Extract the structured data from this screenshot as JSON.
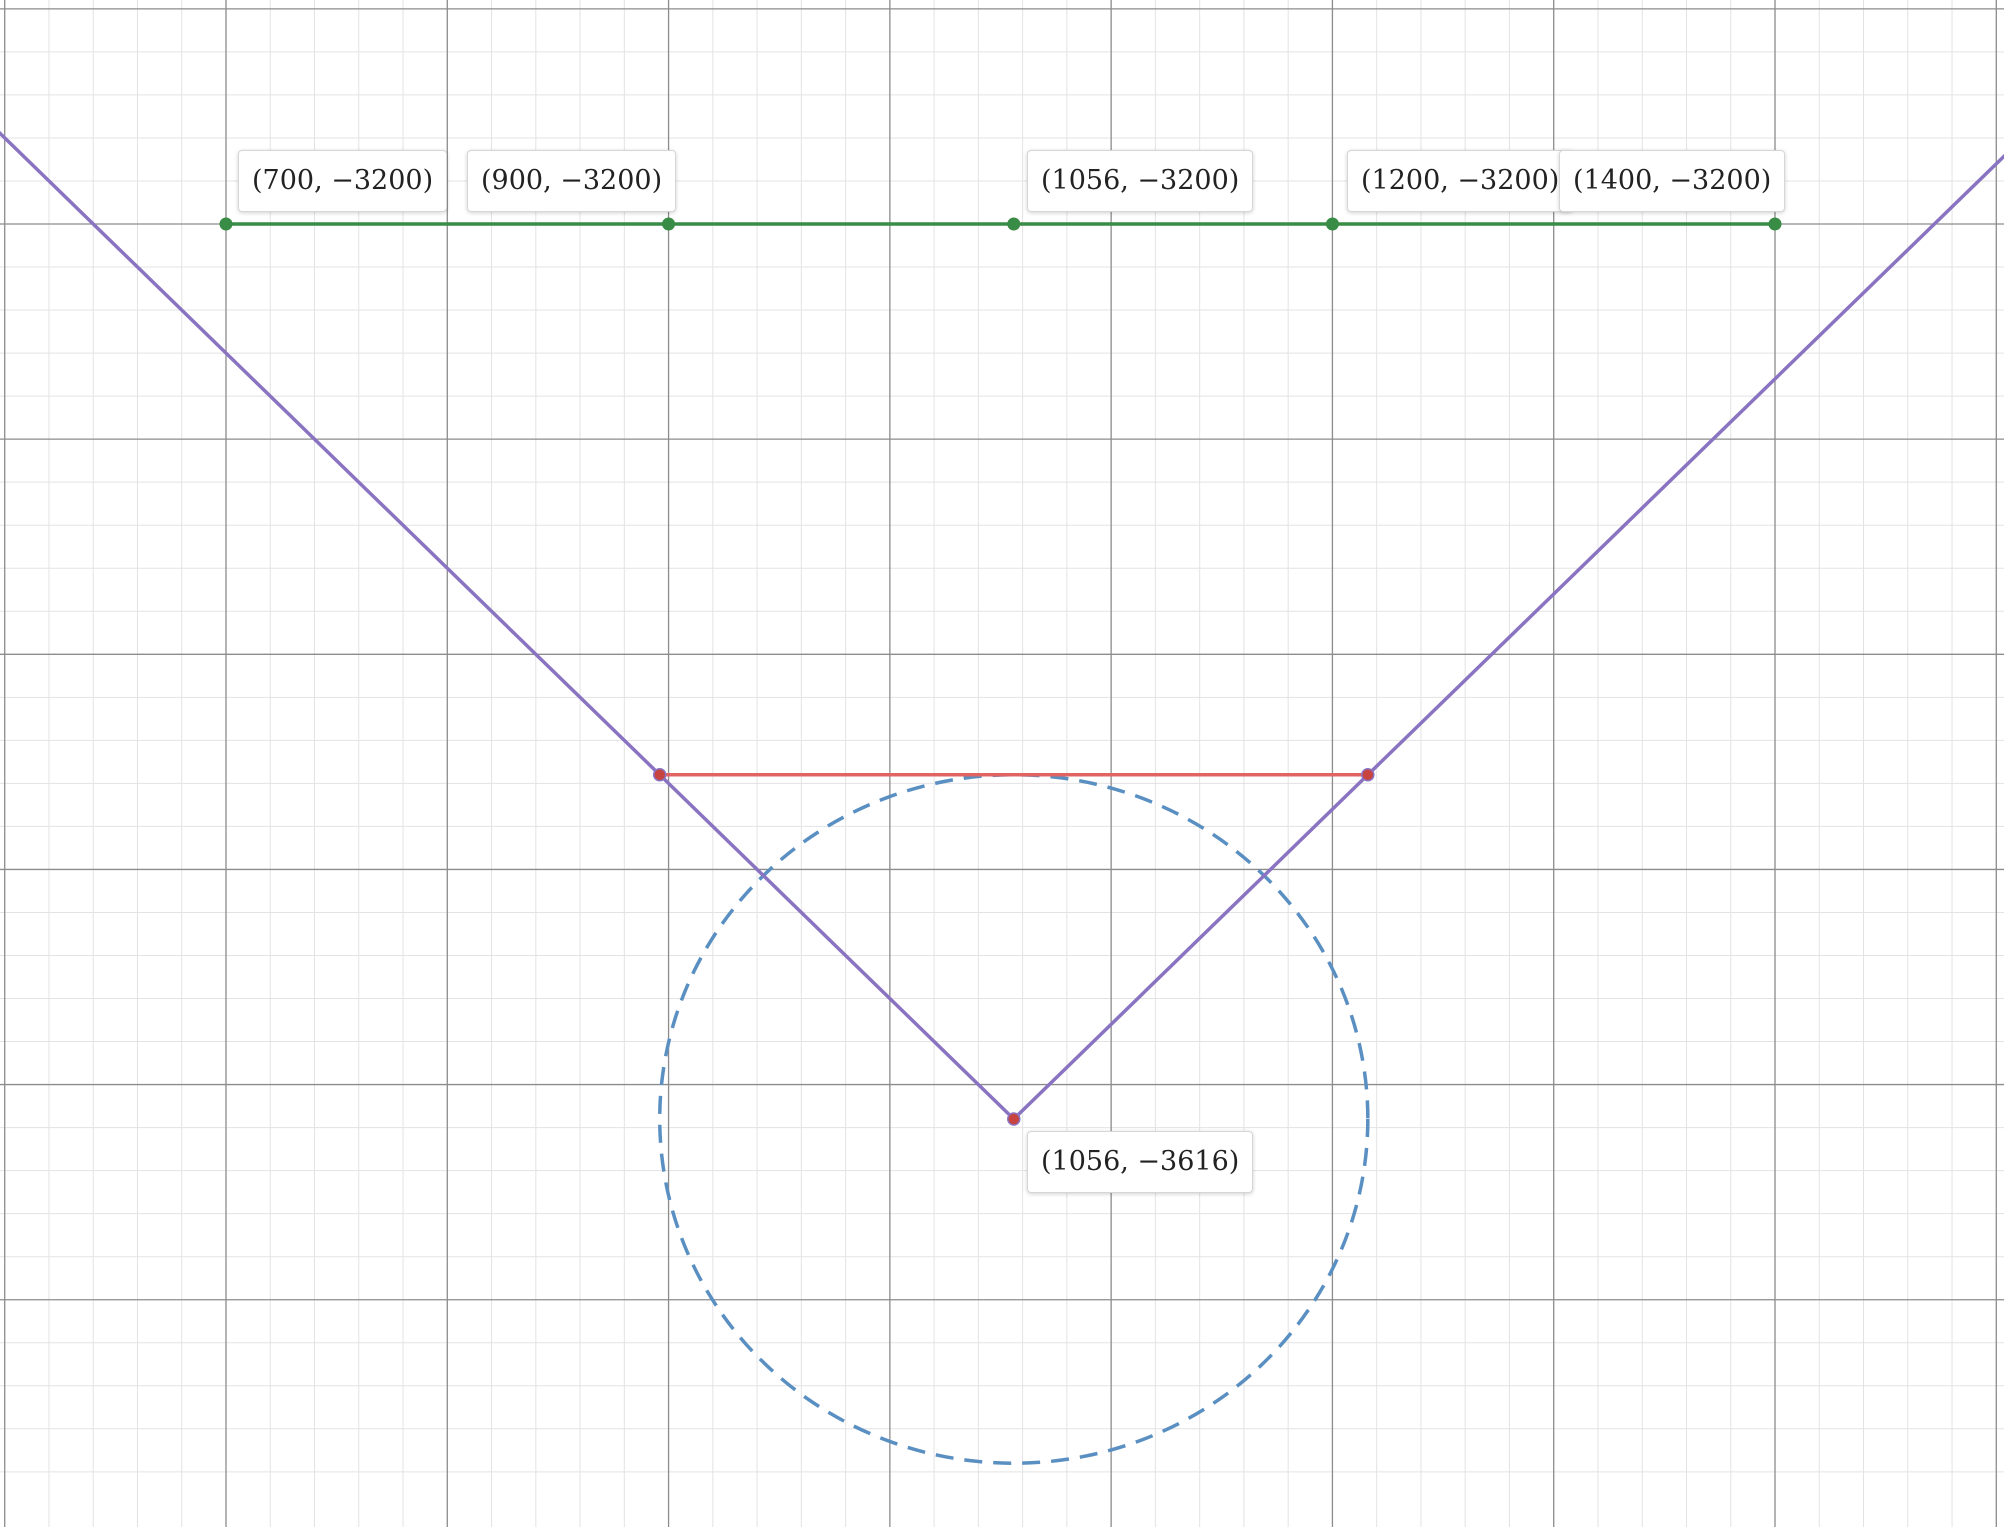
{
  "graph": {
    "background": "#ffffff",
    "colors": {
      "minor_grid": "#e3e3e3",
      "major_grid": "#8c8c8c",
      "green_line": "#388c46",
      "purple_line": "#8a74c2",
      "red_line": "#e06464",
      "red_point": "#c74440",
      "circle": "#5a8fc2"
    },
    "x_range": [
      600,
      1500
    ],
    "y_range": [
      -3780,
      -3100
    ],
    "x_major_step": 100,
    "y_major_step": 100,
    "minor_per_major": 5,
    "green_segment": {
      "y": -3200,
      "x_from": 700,
      "x_to": 1400,
      "points": [
        {
          "x": 700,
          "y": -3200
        },
        {
          "x": 900,
          "y": -3200
        },
        {
          "x": 1056,
          "y": -3200
        },
        {
          "x": 1200,
          "y": -3200
        },
        {
          "x": 1400,
          "y": -3200
        }
      ]
    },
    "v_curve": {
      "vertex": {
        "x": 1056,
        "y": -3616
      },
      "slope": 1
    },
    "red_segment": {
      "from": {
        "x": 896,
        "y": -3456
      },
      "to": {
        "x": 1216,
        "y": -3456
      }
    },
    "circle": {
      "center": {
        "x": 1056,
        "y": -3616
      },
      "radius": 160,
      "dashed": true
    },
    "labels": [
      {
        "text": "(700, −3200)",
        "x": 700,
        "y": -3200
      },
      {
        "text": "(900, −3200)",
        "x": 900,
        "y": -3200
      },
      {
        "text": "(1056, −3200)",
        "x": 1056,
        "y": -3200
      },
      {
        "text": "(1200, −3200)",
        "x": 1200,
        "y": -3200
      },
      {
        "text": "(1400, −3200)",
        "x": 1400,
        "y": -3200
      },
      {
        "text": "(1056, −3616)",
        "x": 1056,
        "y": -3616
      }
    ]
  }
}
